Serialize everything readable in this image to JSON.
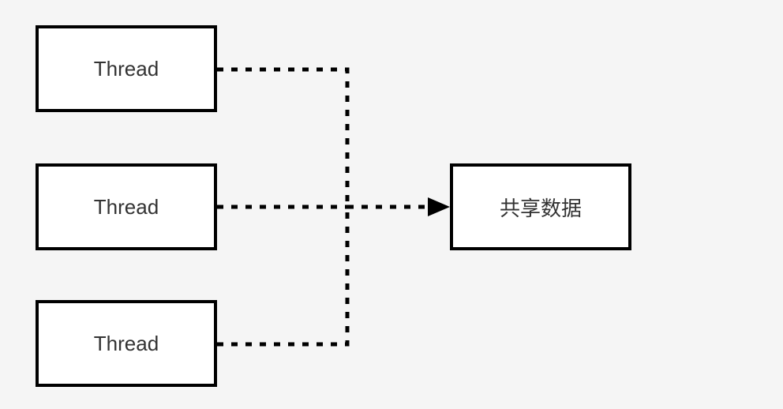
{
  "boxes": {
    "thread1": "Thread",
    "thread2": "Thread",
    "thread3": "Thread",
    "shared": "共享数据"
  },
  "diagram": {
    "description": "Three Thread boxes on the left connected via dashed lines converging to a single shared data box on the right",
    "arrow_style": "dashed",
    "arrow_direction": "left-to-right"
  }
}
